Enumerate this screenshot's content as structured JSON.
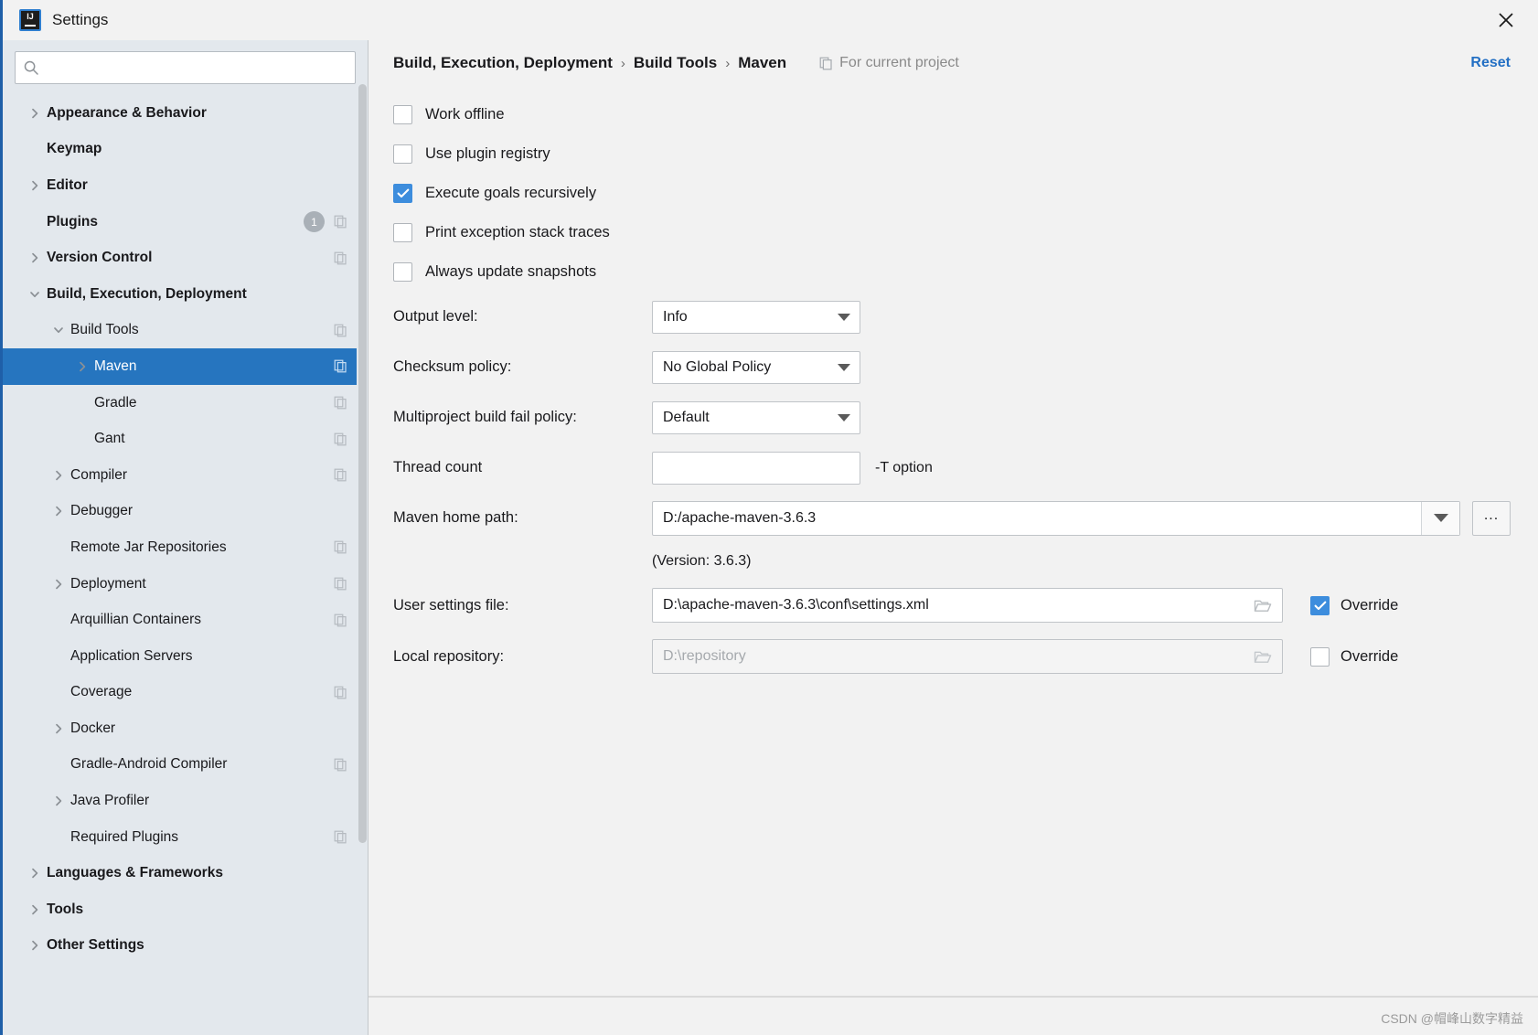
{
  "window": {
    "title": "Settings",
    "logo_icon": "intellij-idea-logo",
    "close_icon": "close-icon"
  },
  "search": {
    "placeholder": "",
    "value": "",
    "icon": "search-icon"
  },
  "sidebar": {
    "items": [
      {
        "label": "Appearance & Behavior",
        "level": 0,
        "twisty": "chevron-right",
        "copy": false,
        "selected": false
      },
      {
        "label": "Keymap",
        "level": 0,
        "twisty": "none",
        "copy": false,
        "selected": false
      },
      {
        "label": "Editor",
        "level": 0,
        "twisty": "chevron-right",
        "copy": false,
        "selected": false
      },
      {
        "label": "Plugins",
        "level": 0,
        "twisty": "none",
        "copy": true,
        "selected": false,
        "badge": "1"
      },
      {
        "label": "Version Control",
        "level": 0,
        "twisty": "chevron-right",
        "copy": true,
        "selected": false
      },
      {
        "label": "Build, Execution, Deployment",
        "level": 0,
        "twisty": "chevron-down",
        "copy": false,
        "selected": false
      },
      {
        "label": "Build Tools",
        "level": 1,
        "twisty": "chevron-down",
        "copy": true,
        "selected": false
      },
      {
        "label": "Maven",
        "level": 2,
        "twisty": "chevron-right",
        "copy": true,
        "selected": true
      },
      {
        "label": "Gradle",
        "level": 2,
        "twisty": "none",
        "copy": true,
        "selected": false
      },
      {
        "label": "Gant",
        "level": 2,
        "twisty": "none",
        "copy": true,
        "selected": false
      },
      {
        "label": "Compiler",
        "level": 1,
        "twisty": "chevron-right",
        "copy": true,
        "selected": false
      },
      {
        "label": "Debugger",
        "level": 1,
        "twisty": "chevron-right",
        "copy": false,
        "selected": false
      },
      {
        "label": "Remote Jar Repositories",
        "level": 1,
        "twisty": "none",
        "copy": true,
        "selected": false
      },
      {
        "label": "Deployment",
        "level": 1,
        "twisty": "chevron-right",
        "copy": true,
        "selected": false
      },
      {
        "label": "Arquillian Containers",
        "level": 1,
        "twisty": "none",
        "copy": true,
        "selected": false
      },
      {
        "label": "Application Servers",
        "level": 1,
        "twisty": "none",
        "copy": false,
        "selected": false
      },
      {
        "label": "Coverage",
        "level": 1,
        "twisty": "none",
        "copy": true,
        "selected": false
      },
      {
        "label": "Docker",
        "level": 1,
        "twisty": "chevron-right",
        "copy": false,
        "selected": false
      },
      {
        "label": "Gradle-Android Compiler",
        "level": 1,
        "twisty": "none",
        "copy": true,
        "selected": false
      },
      {
        "label": "Java Profiler",
        "level": 1,
        "twisty": "chevron-right",
        "copy": false,
        "selected": false
      },
      {
        "label": "Required Plugins",
        "level": 1,
        "twisty": "none",
        "copy": true,
        "selected": false
      },
      {
        "label": "Languages & Frameworks",
        "level": 0,
        "twisty": "chevron-right",
        "copy": false,
        "selected": false
      },
      {
        "label": "Tools",
        "level": 0,
        "twisty": "chevron-right",
        "copy": false,
        "selected": false
      },
      {
        "label": "Other Settings",
        "level": 0,
        "twisty": "chevron-right",
        "copy": false,
        "selected": false
      }
    ]
  },
  "header": {
    "breadcrumb": [
      "Build, Execution, Deployment",
      "Build Tools",
      "Maven"
    ],
    "separator": "›",
    "for_project_label": "For current project",
    "for_project_icon": "copy-icon",
    "reset_label": "Reset"
  },
  "main": {
    "checkboxes": [
      {
        "label": "Work offline",
        "checked": false
      },
      {
        "label": "Use plugin registry",
        "checked": false
      },
      {
        "label": "Execute goals recursively",
        "checked": true
      },
      {
        "label": "Print exception stack traces",
        "checked": false
      },
      {
        "label": "Always update snapshots",
        "checked": false
      }
    ],
    "output_level": {
      "label": "Output level:",
      "value": "Info",
      "caret_icon": "chevron-down-icon"
    },
    "checksum_policy": {
      "label": "Checksum policy:",
      "value": "No Global Policy",
      "caret_icon": "chevron-down-icon"
    },
    "fail_policy": {
      "label": "Multiproject build fail policy:",
      "value": "Default",
      "caret_icon": "chevron-down-icon"
    },
    "thread_count": {
      "label": "Thread count",
      "value": "",
      "placeholder": "",
      "hint": "-T option"
    },
    "maven_home": {
      "label": "Maven home path:",
      "value": "D:/apache-maven-3.6.3",
      "caret_icon": "chevron-down-icon",
      "browse_label": "...",
      "version_text": "(Version: 3.6.3)"
    },
    "user_settings": {
      "label": "User settings file:",
      "value": "D:\\apache-maven-3.6.3\\conf\\settings.xml",
      "folder_icon": "folder-icon",
      "override_label": "Override",
      "override_checked": true,
      "disabled": false
    },
    "local_repository": {
      "label": "Local repository:",
      "value": "D:\\repository",
      "folder_icon": "folder-icon",
      "override_label": "Override",
      "override_checked": false,
      "disabled": true
    }
  },
  "watermark": "CSDN @帽峰山数字精益",
  "colors": {
    "accent": "#2675bf",
    "checkbox_checked": "#3d8ddd",
    "link": "#2470c4",
    "sidebar_bg": "#e3e8ed",
    "panel_bg": "#f2f2f2"
  }
}
